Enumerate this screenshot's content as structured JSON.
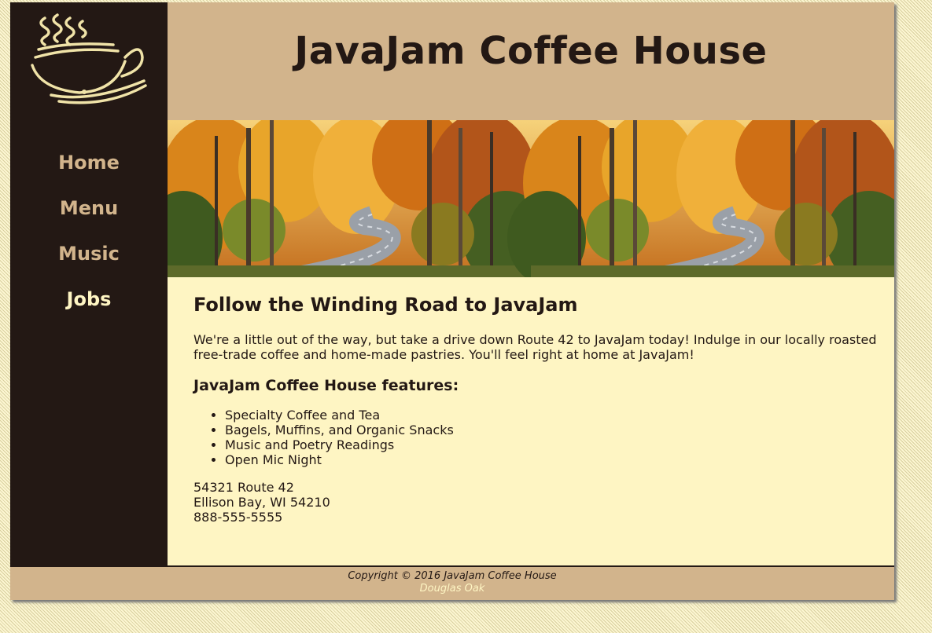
{
  "site": {
    "title": "JavaJam Coffee House",
    "logo_icon": "steaming-coffee-cup-icon"
  },
  "nav": {
    "items": [
      {
        "label": "Home",
        "current": false
      },
      {
        "label": "Menu",
        "current": false
      },
      {
        "label": "Music",
        "current": false
      },
      {
        "label": "Jobs",
        "current": true
      }
    ]
  },
  "hero": {
    "description_icon": "winding-road-autumn-forest-image"
  },
  "main": {
    "heading": "Follow the Winding Road to JavaJam",
    "intro": "We're a little out of the way, but take a drive down Route 42 to JavaJam today! Indulge in our locally roasted free-trade coffee and home-made pastries. You'll feel right at home at JavaJam!",
    "features_heading": "JavaJam Coffee House features:",
    "features": [
      "Specialty Coffee and Tea",
      "Bagels, Muffins, and Organic Snacks",
      "Music and Poetry Readings",
      "Open Mic Night"
    ],
    "address": {
      "street": "54321 Route 42",
      "city": "Ellison Bay, WI 54210",
      "phone": "888-555-5555"
    }
  },
  "footer": {
    "copyright": "Copyright © 2016 JavaJam Coffee House",
    "author": "Douglas Oak"
  },
  "colors": {
    "dark": "#231814",
    "tan": "#d2b48c",
    "cream": "#fef5c3"
  }
}
